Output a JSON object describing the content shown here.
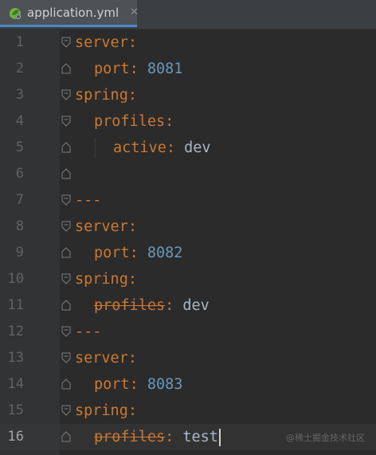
{
  "tab": {
    "icon": "spring-leaf-icon",
    "title": "application.yml",
    "close": "✕"
  },
  "colors": {
    "key": "#cc7832",
    "number": "#6897bb",
    "text": "#a9b7c6",
    "background": "#2b2b2b"
  },
  "lines": [
    {
      "num": "1",
      "key": "server",
      "sep": ":",
      "value": ""
    },
    {
      "num": "2",
      "key": "port",
      "sep": ":",
      "value": "8081"
    },
    {
      "num": "3",
      "key": "spring",
      "sep": ":",
      "value": ""
    },
    {
      "num": "4",
      "key": "profiles",
      "sep": ":",
      "value": ""
    },
    {
      "num": "5",
      "key": "active",
      "sep": ":",
      "value": "dev"
    },
    {
      "num": "6",
      "key": "",
      "sep": "",
      "value": ""
    },
    {
      "num": "7",
      "key": "---",
      "sep": "",
      "value": ""
    },
    {
      "num": "8",
      "key": "server",
      "sep": ":",
      "value": ""
    },
    {
      "num": "9",
      "key": "port",
      "sep": ":",
      "value": "8082"
    },
    {
      "num": "10",
      "key": "spring",
      "sep": ":",
      "value": ""
    },
    {
      "num": "11",
      "key": "profiles",
      "sep": ":",
      "value": "dev",
      "deprecated": true
    },
    {
      "num": "12",
      "key": "---",
      "sep": "",
      "value": ""
    },
    {
      "num": "13",
      "key": "server",
      "sep": ":",
      "value": ""
    },
    {
      "num": "14",
      "key": "port",
      "sep": ":",
      "value": "8083"
    },
    {
      "num": "15",
      "key": "spring",
      "sep": ":",
      "value": ""
    },
    {
      "num": "16",
      "key": "profiles",
      "sep": ":",
      "value": "test",
      "deprecated": true,
      "current": true
    }
  ],
  "watermark": "@稀土掘金技术社区"
}
